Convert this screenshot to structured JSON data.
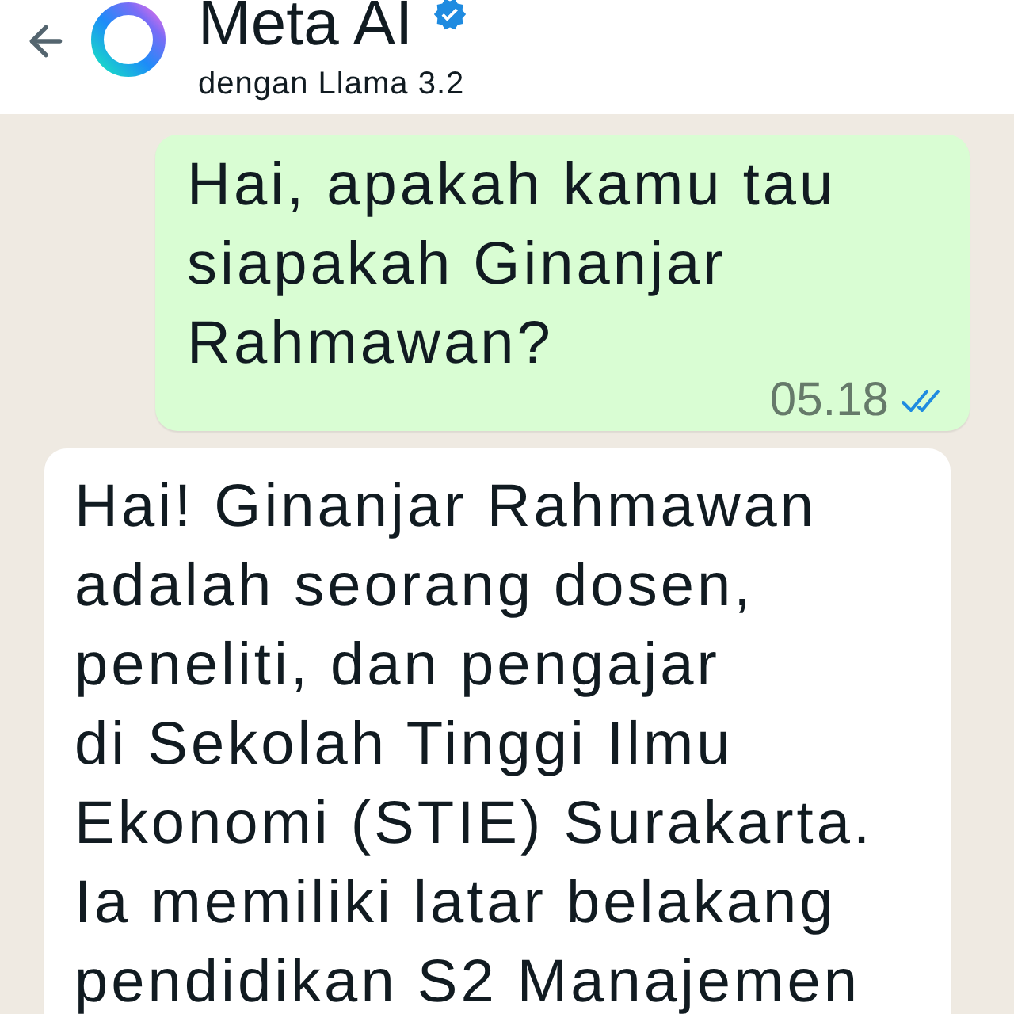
{
  "header": {
    "title": "Meta AI",
    "verified": true,
    "subtitle": "dengan Llama 3.2"
  },
  "messages": [
    {
      "kind": "sent",
      "text": "Hai, apakah kamu tau\nsiapakah Ginanjar\nRahmawan?",
      "time": "05.18",
      "read": true
    },
    {
      "kind": "received",
      "text": "Hai! Ginanjar Rahmawan\nadalah seorang dosen,\npeneliti, dan pengajar\ndi Sekolah Tinggi Ilmu\nEkonomi (STIE) Surakarta.\nIa memiliki latar belakang\npendidikan S2 Manajemen"
    }
  ]
}
